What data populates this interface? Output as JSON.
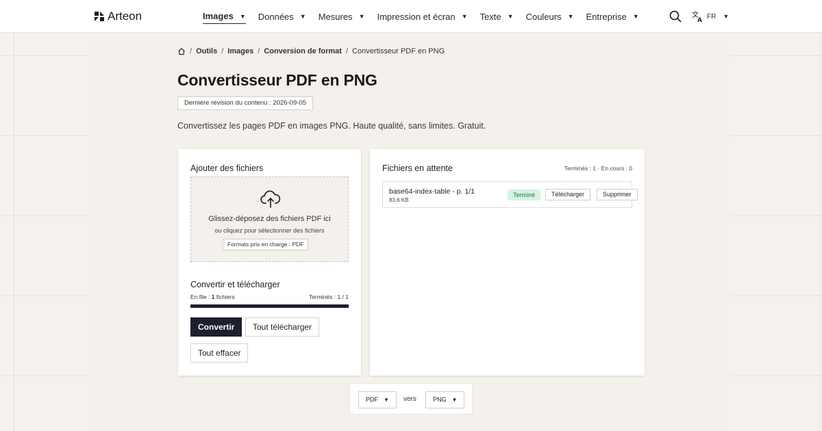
{
  "brand": {
    "name": "Arteon"
  },
  "nav": {
    "items": [
      {
        "label": "Images",
        "active": true
      },
      {
        "label": "Données"
      },
      {
        "label": "Mesures"
      },
      {
        "label": "Impression et écran"
      },
      {
        "label": "Texte"
      },
      {
        "label": "Couleurs"
      },
      {
        "label": "Entreprise"
      }
    ],
    "lang": "FR"
  },
  "breadcrumb": [
    "Outils",
    "Images",
    "Conversion de format",
    "Convertisseur PDF en PNG"
  ],
  "page": {
    "title": "Convertisseur PDF en PNG",
    "revision": "Dernière révision du contenu : 2026-09-05",
    "description": "Convertissez les pages PDF en images PNG. Haute qualité, sans limites. Gratuit."
  },
  "upload": {
    "title": "Ajouter des fichiers",
    "drop_main": "Glissez-déposez des fichiers PDF ici",
    "drop_sub": "ou cliquez pour sélectionner des fichiers",
    "formats": "Formats pris en charge : PDF"
  },
  "convert": {
    "title": "Convertir et télécharger",
    "queue_prefix": "En file : ",
    "queue_count": "1",
    "queue_suffix": " fichiers",
    "done": "Terminés : 1 / 1",
    "progress_fraction": 1.0,
    "btn_convert": "Convertir",
    "btn_download_all": "Tout télécharger",
    "btn_clear": "Tout effacer"
  },
  "pending": {
    "title": "Fichiers en attente",
    "stats": "Terminés : 1 · En cours : 0",
    "files": [
      {
        "name": "base64-index-table - p. 1/1",
        "size": "83.6 KB",
        "status": "Terminé",
        "download": "Télécharger",
        "delete": "Supprimer"
      }
    ]
  },
  "switcher": {
    "from": "PDF",
    "to": "PNG",
    "between": "vers"
  },
  "colors": {
    "accent": "#1c1f2e",
    "success_bg": "#d7f3e1",
    "success_text": "#1f7a44"
  }
}
